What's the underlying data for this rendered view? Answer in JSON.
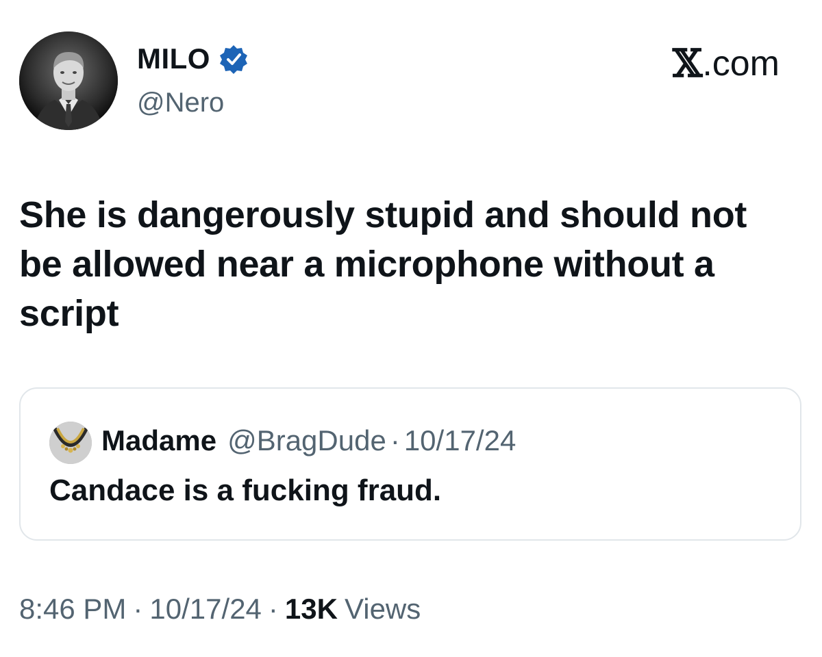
{
  "author": {
    "display_name": "MILO",
    "handle": "@Nero",
    "verified": true,
    "avatar_icon": "profile-photo",
    "verified_color": "#1d64b6"
  },
  "brand": {
    "mark": "𝕏",
    "suffix": ".com"
  },
  "tweet": {
    "text": "She is dangerously stupid and should not be allowed near a microphone without a script"
  },
  "quote": {
    "display_name": "Madame",
    "handle": "@BragDude",
    "separator": "·",
    "date": "10/17/24",
    "text": "Candace is a fucking fraud.",
    "avatar_icon": "gold-chain-avatar"
  },
  "meta": {
    "time": "8:46 PM",
    "separator": "·",
    "date": "10/17/24",
    "views_count": "13K",
    "views_label": "Views"
  },
  "colors": {
    "text_primary": "#0f1419",
    "text_secondary": "#536471",
    "border": "#e1e6ea"
  }
}
